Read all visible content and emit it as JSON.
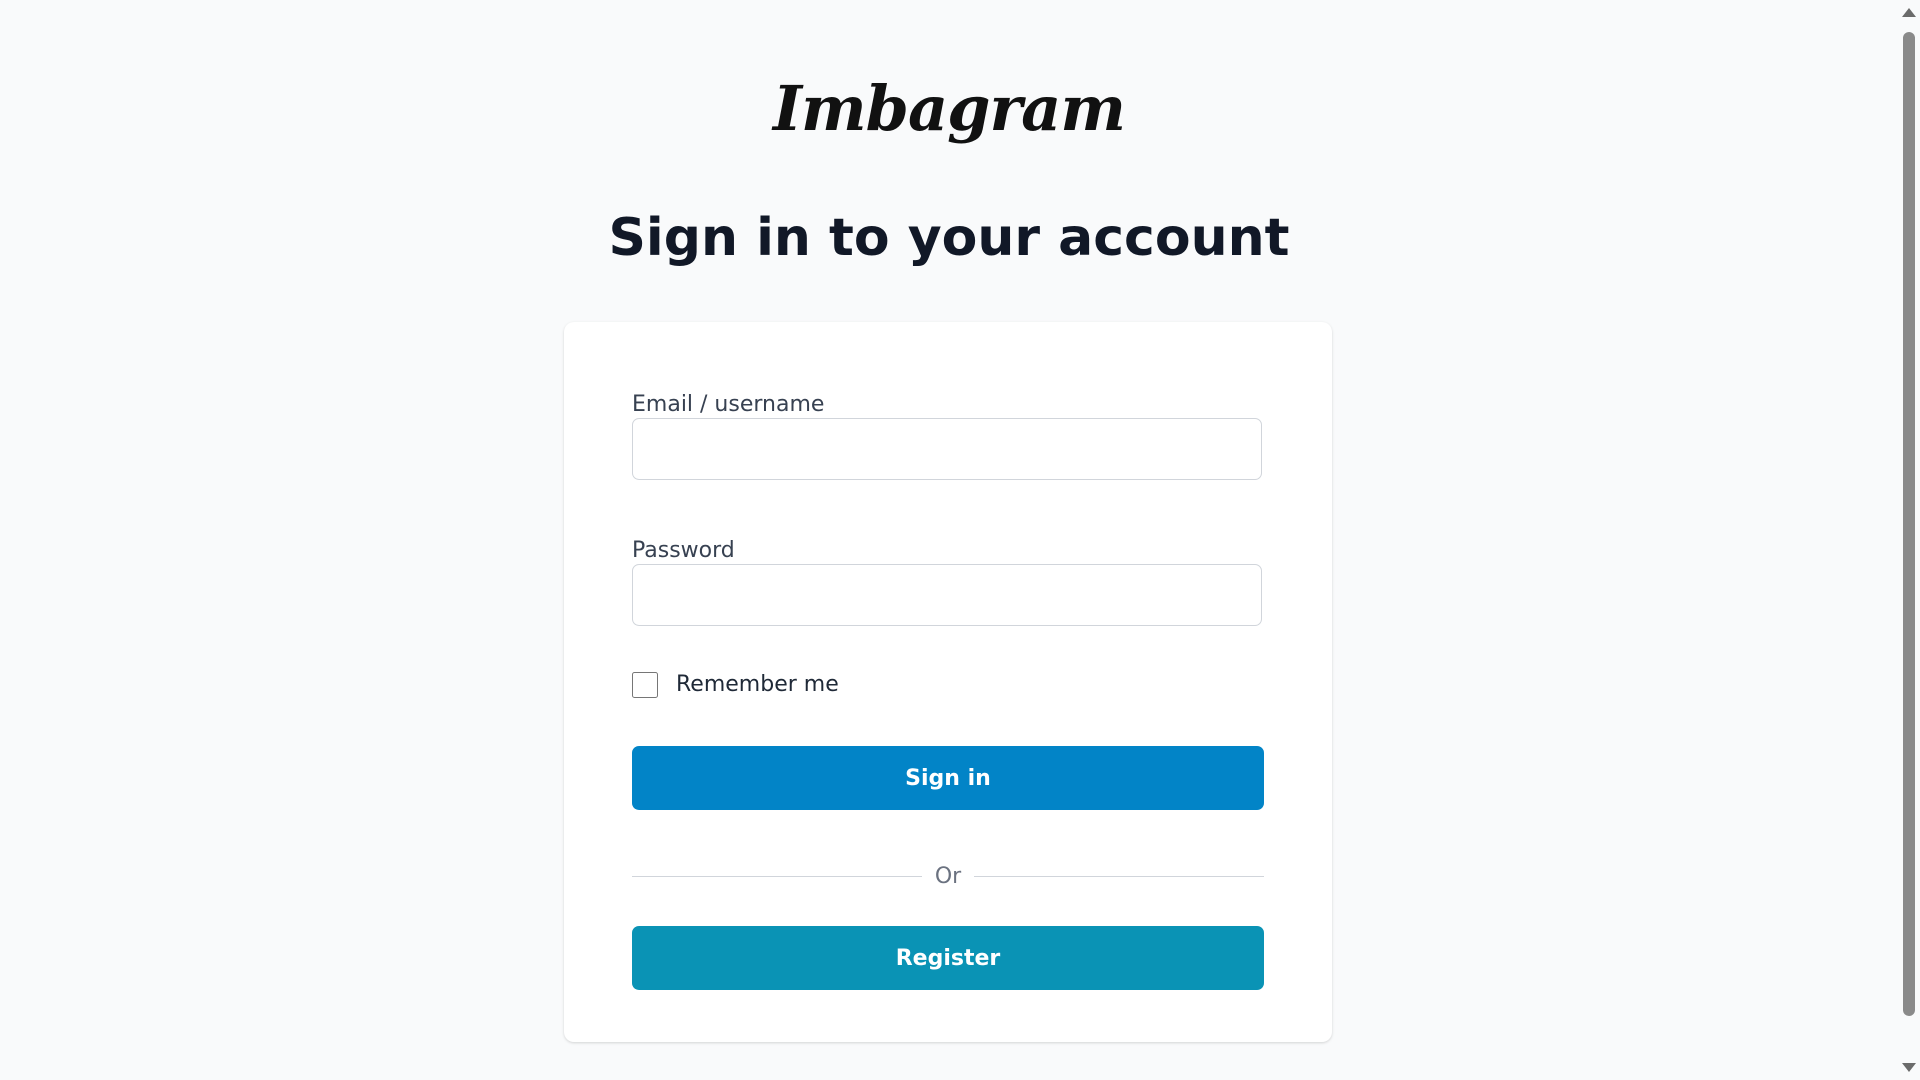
{
  "brand": {
    "logo_text": "Imbagram"
  },
  "page": {
    "title": "Sign in to your account"
  },
  "form": {
    "email_label": "Email / username",
    "email_value": "",
    "password_label": "Password",
    "password_value": "",
    "remember_label": "Remember me",
    "remember_checked": false,
    "signin_label": "Sign in",
    "divider_text": "Or",
    "register_label": "Register"
  },
  "colors": {
    "background": "#f9fafb",
    "card": "#ffffff",
    "signin_button": "#0284c7",
    "register_button": "#0a93b5",
    "title_text": "#111827"
  }
}
